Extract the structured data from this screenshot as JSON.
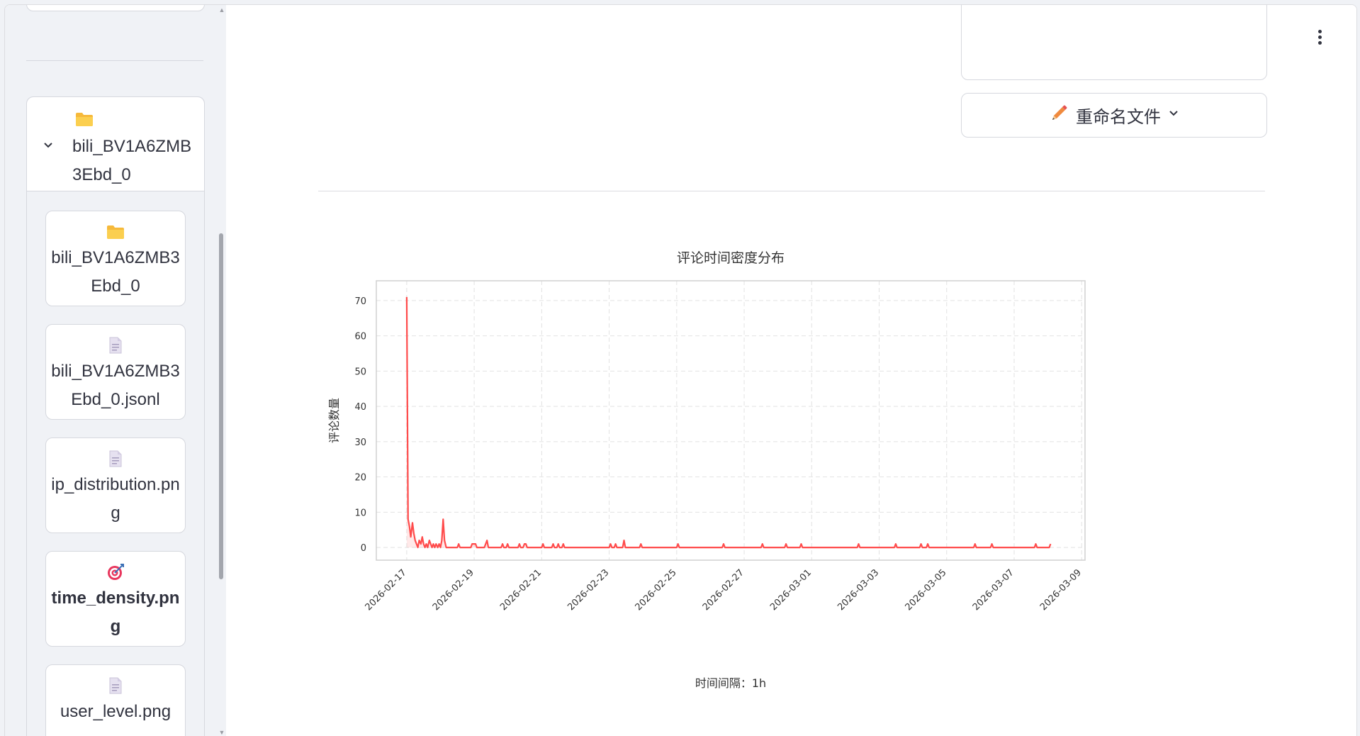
{
  "sidebar": {
    "folder": {
      "name": "bili_BV1A6ZMB3Ebd_0",
      "icon": "folder-icon",
      "expanded": true
    },
    "files": [
      {
        "name": "bili_BV1A6ZMB3Ebd_0",
        "icon": "folder-icon",
        "selected": false
      },
      {
        "name": "bili_BV1A6ZMB3Ebd_0.jsonl",
        "icon": "document-icon",
        "selected": false
      },
      {
        "name": "ip_distribution.png",
        "icon": "document-icon",
        "selected": false
      },
      {
        "name": "time_density.png",
        "icon": "target-icon",
        "selected": true
      },
      {
        "name": "user_level.png",
        "icon": "document-icon",
        "selected": false
      }
    ]
  },
  "main": {
    "rename_button": {
      "label": "重命名文件",
      "icon": "pencil-icon"
    },
    "menu_icon": "kebab-menu-icon"
  },
  "colors": {
    "line": "#ff4b4b",
    "accent": "#ff4b4b",
    "border": "#d6d8de"
  },
  "chart_data": {
    "type": "line",
    "title": "评论时间密度分布",
    "xlabel": "时间间隔：1h",
    "ylabel": "评论数量",
    "ylim": [
      -3.6,
      75.6
    ],
    "yticks": [
      0,
      10,
      20,
      30,
      40,
      50,
      60,
      70
    ],
    "xticks": [
      "2026-02-17",
      "2026-02-19",
      "2026-02-21",
      "2026-02-23",
      "2026-02-25",
      "2026-02-27",
      "2026-03-01",
      "2026-03-03",
      "2026-03-05",
      "2026-03-07",
      "2026-03-09"
    ],
    "xlim_days": [
      -0.9,
      20.1
    ],
    "grid": true,
    "series": [
      {
        "points": [
          [
            0.0,
            71
          ],
          [
            0.04,
            8
          ],
          [
            0.08,
            6
          ],
          [
            0.12,
            3
          ],
          [
            0.17,
            7
          ],
          [
            0.21,
            4
          ],
          [
            0.25,
            2
          ],
          [
            0.29,
            1
          ],
          [
            0.33,
            0
          ],
          [
            0.37,
            2
          ],
          [
            0.42,
            1
          ],
          [
            0.46,
            3
          ],
          [
            0.5,
            1
          ],
          [
            0.54,
            0
          ],
          [
            0.58,
            1
          ],
          [
            0.62,
            0
          ],
          [
            0.67,
            2
          ],
          [
            0.71,
            1
          ],
          [
            0.75,
            0
          ],
          [
            0.79,
            1
          ],
          [
            0.83,
            0
          ],
          [
            0.87,
            1
          ],
          [
            0.92,
            0
          ],
          [
            0.96,
            1
          ],
          [
            1.0,
            0
          ],
          [
            1.04,
            2
          ],
          [
            1.08,
            8
          ],
          [
            1.12,
            2
          ],
          [
            1.17,
            0
          ],
          [
            1.5,
            0
          ],
          [
            1.54,
            1
          ],
          [
            1.58,
            0
          ],
          [
            1.9,
            0
          ],
          [
            1.94,
            1
          ],
          [
            2.04,
            1
          ],
          [
            2.08,
            0
          ],
          [
            2.3,
            0
          ],
          [
            2.34,
            1
          ],
          [
            2.38,
            2
          ],
          [
            2.42,
            0
          ],
          [
            2.8,
            0
          ],
          [
            2.84,
            1
          ],
          [
            2.88,
            0
          ],
          [
            2.95,
            0
          ],
          [
            2.99,
            1
          ],
          [
            3.03,
            0
          ],
          [
            3.3,
            0
          ],
          [
            3.34,
            1
          ],
          [
            3.38,
            0
          ],
          [
            3.45,
            0
          ],
          [
            3.49,
            1
          ],
          [
            3.53,
            1
          ],
          [
            3.57,
            0
          ],
          [
            4.0,
            0
          ],
          [
            4.04,
            1
          ],
          [
            4.08,
            0
          ],
          [
            4.3,
            0
          ],
          [
            4.34,
            1
          ],
          [
            4.38,
            0
          ],
          [
            4.45,
            0
          ],
          [
            4.49,
            1
          ],
          [
            4.53,
            0
          ],
          [
            4.6,
            0
          ],
          [
            4.64,
            1
          ],
          [
            4.68,
            0
          ],
          [
            6.0,
            0
          ],
          [
            6.04,
            1
          ],
          [
            6.08,
            0
          ],
          [
            6.15,
            0
          ],
          [
            6.19,
            1
          ],
          [
            6.23,
            0
          ],
          [
            6.4,
            0
          ],
          [
            6.44,
            2
          ],
          [
            6.48,
            0
          ],
          [
            6.9,
            0
          ],
          [
            6.94,
            1
          ],
          [
            6.98,
            0
          ],
          [
            8.0,
            0
          ],
          [
            8.04,
            1
          ],
          [
            8.08,
            0
          ],
          [
            9.35,
            0
          ],
          [
            9.39,
            1
          ],
          [
            9.43,
            0
          ],
          [
            10.5,
            0
          ],
          [
            10.54,
            1
          ],
          [
            10.58,
            0
          ],
          [
            11.2,
            0
          ],
          [
            11.24,
            1
          ],
          [
            11.28,
            0
          ],
          [
            11.65,
            0
          ],
          [
            11.69,
            1
          ],
          [
            11.73,
            0
          ],
          [
            13.35,
            0
          ],
          [
            13.39,
            1
          ],
          [
            13.43,
            0
          ],
          [
            14.45,
            0
          ],
          [
            14.49,
            1
          ],
          [
            14.53,
            0
          ],
          [
            15.2,
            0
          ],
          [
            15.24,
            1
          ],
          [
            15.28,
            0
          ],
          [
            15.4,
            0
          ],
          [
            15.44,
            1
          ],
          [
            15.48,
            0
          ],
          [
            16.8,
            0
          ],
          [
            16.84,
            1
          ],
          [
            16.88,
            0
          ],
          [
            17.3,
            0
          ],
          [
            17.34,
            1
          ],
          [
            17.38,
            0
          ],
          [
            18.6,
            0
          ],
          [
            18.64,
            1
          ],
          [
            18.68,
            0
          ],
          [
            19.04,
            0
          ],
          [
            19.08,
            1
          ]
        ]
      }
    ]
  }
}
